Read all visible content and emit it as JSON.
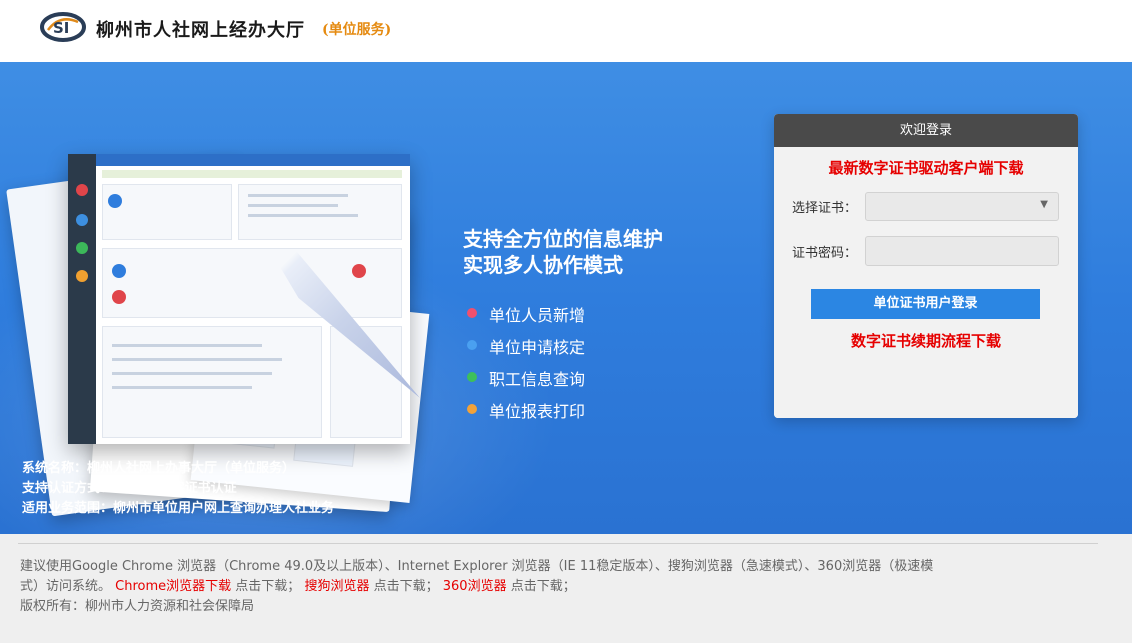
{
  "header": {
    "logo_text": "SI",
    "title": "柳州市人社网上经办大厅",
    "subtitle": "(单位服务)"
  },
  "features": {
    "title_line1": "支持全方位的信息维护",
    "title_line2": "实现多人协作模式",
    "items": [
      {
        "label": "单位人员新增",
        "color": "#f0506e"
      },
      {
        "label": "单位申请核定",
        "color": "#4aa0f0"
      },
      {
        "label": "职工信息查询",
        "color": "#3dbf5a"
      },
      {
        "label": "单位报表打印",
        "color": "#f2a23a"
      }
    ]
  },
  "sysinfo": {
    "name": "系统名称：柳州人社网上办事大厅（单位服务）",
    "auth": "支持认证方式：CA免费数字证书认证",
    "scope": "适用业务范围：柳州市单位用户网上查询办理人社业务"
  },
  "login": {
    "header": "欢迎登录",
    "driver_link": "最新数字证书驱动客户端下载",
    "cert_label": "选择证书：",
    "cert_value": "",
    "pwd_label": "证书密码：",
    "pwd_placeholder": "",
    "submit": "单位证书用户登录",
    "renew_link": "数字证书续期流程下载"
  },
  "footer": {
    "line1": "建议使用Google Chrome 浏览器（Chrome 49.0及以上版本）、Internet Explorer 浏览器（IE 11稳定版本）、搜狗浏览器（急速模式）、360浏览器（极速模",
    "line2_prefix": "式）访问系统。",
    "chrome_link": "Chrome浏览器下载",
    "click1": "点击下载；",
    "sogou_link": "搜狗浏览器",
    "click2": "点击下载；",
    "b360_link": "360浏览器",
    "click3": "点击下载；",
    "copyright": "版权所有：柳州市人力资源和社会保障局"
  }
}
